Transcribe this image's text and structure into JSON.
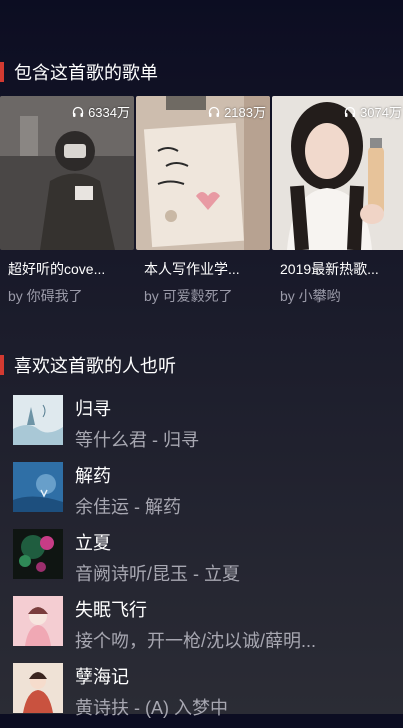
{
  "section_playlists": {
    "title": "包含这首歌的歌单"
  },
  "playlists": [
    {
      "name": "超好听的cove...",
      "creator": "by 你碍我了",
      "play_count": "6334万"
    },
    {
      "name": "本人写作业学...",
      "creator": "by 可爱豰死了",
      "play_count": "2183万"
    },
    {
      "name": "2019最新热歌...",
      "creator": "by 小攀哟",
      "play_count": "3074万"
    }
  ],
  "section_similar": {
    "title": "喜欢这首歌的人也听"
  },
  "songs": [
    {
      "title": "归寻",
      "subtitle": "等什么君 - 归寻"
    },
    {
      "title": "解药",
      "subtitle": "余佳运 - 解药"
    },
    {
      "title": "立夏",
      "subtitle": "音阙诗听/昆玉 - 立夏"
    },
    {
      "title": "失眠飞行",
      "subtitle": "接个吻，开一枪/沈以诚/薛明..."
    },
    {
      "title": "孽海记",
      "subtitle": "黄诗扶 - (A) 入梦中"
    }
  ],
  "icons": {
    "play_count": "headphones-icon"
  },
  "colors": {
    "accent": "#d33a31",
    "background": "#16172a"
  }
}
